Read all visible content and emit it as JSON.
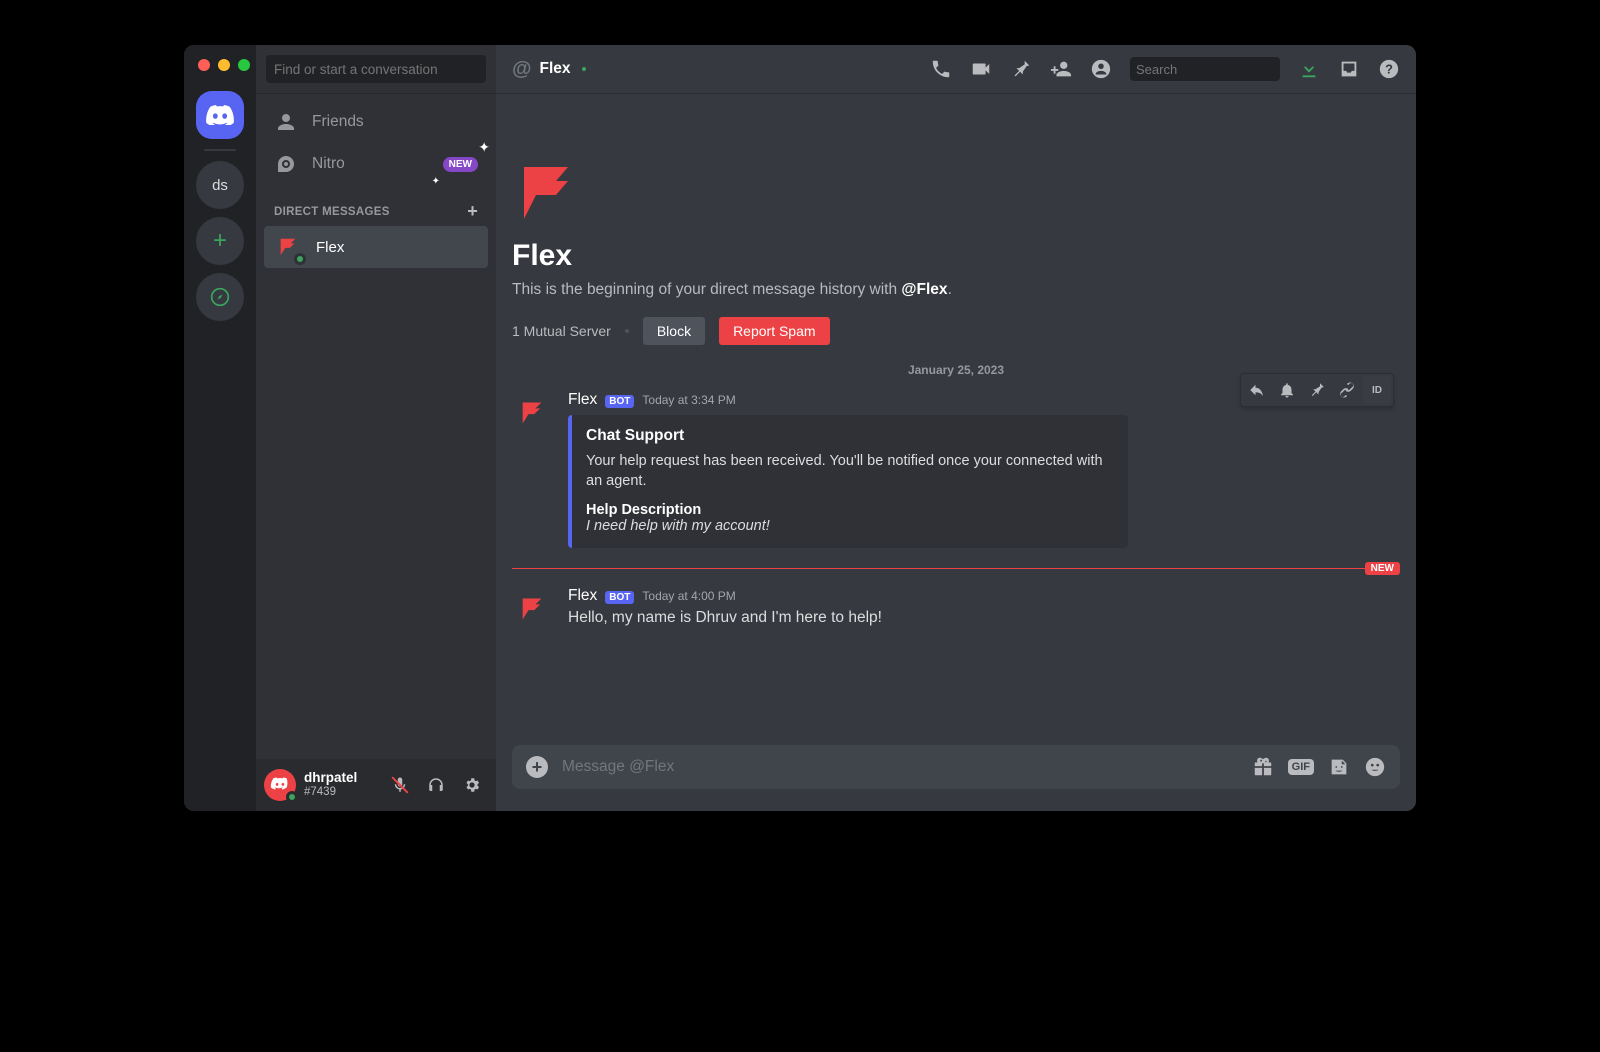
{
  "servers": {
    "ds_label": "ds"
  },
  "sidebar": {
    "search_placeholder": "Find or start a conversation",
    "friends_label": "Friends",
    "nitro_label": "Nitro",
    "nitro_badge": "NEW",
    "dm_header": "DIRECT MESSAGES",
    "dm_items": [
      {
        "name": "Flex"
      }
    ]
  },
  "user_panel": {
    "name": "dhrpatel",
    "tag": "#7439"
  },
  "titlebar": {
    "at": "@",
    "title": "Flex",
    "search_placeholder": "Search"
  },
  "hero": {
    "name": "Flex",
    "text_pre": "This is the beginning of your direct message history with ",
    "text_bold": "@Flex",
    "text_post": ".",
    "mutual": "1 Mutual Server",
    "block": "Block",
    "report": "Report Spam"
  },
  "date_divider": "January 25, 2023",
  "messages": [
    {
      "author": "Flex",
      "bot": "BOT",
      "timestamp": "Today at 3:34 PM",
      "embed": {
        "title": "Chat Support",
        "description": "Your help request has been received. You'll be notified once your connected with an agent.",
        "field_title": "Help Description",
        "field_value": "I need help with my account!"
      }
    },
    {
      "author": "Flex",
      "bot": "BOT",
      "timestamp": "Today at 4:00 PM",
      "text": "Hello, my name is Dhruv and I'm here to help!"
    }
  ],
  "new_divider": "NEW",
  "composer": {
    "placeholder": "Message @Flex"
  },
  "msg_toolbar": {
    "id": "ID"
  }
}
